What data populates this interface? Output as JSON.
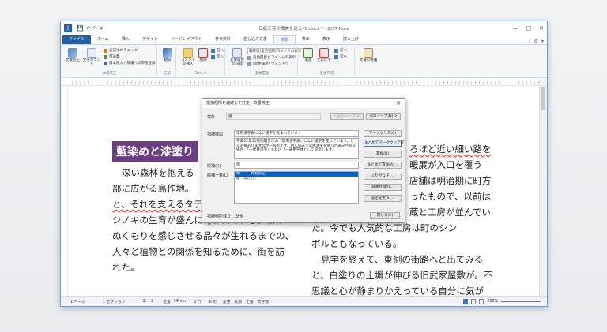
{
  "window": {
    "title": "伝統工芸の職美を巡るPC.docx * - JUST Note",
    "app_icon": "J",
    "qat": [
      "💾",
      "↶",
      "↷",
      "▾"
    ],
    "controls": [
      "—",
      "□",
      "✕"
    ]
  },
  "tabs": [
    "ファイル",
    "ホーム",
    "挿入",
    "デザイン",
    "ページレイアウト",
    "参考資料",
    "差し込み文書",
    "校閲",
    "表示",
    "表示",
    "読み上げ"
  ],
  "tab_right": [
    "?",
    "⚙",
    "▾"
  ],
  "ribbon": {
    "groups": [
      "文書校正",
      "言語",
      "コメント",
      "変更履歴",
      "変更内容"
    ],
    "proof": {
      "check": "文書校正",
      "count": "文字カウント",
      "items": [
        "表記ゆれチェック",
        "用語集",
        "日本語入力辞書への単語登録"
      ]
    },
    "lang": {
      "translate": "翻訳"
    },
    "comment": {
      "insert": "コメントの挿入",
      "delete": "削除",
      "prev": "前へ",
      "next": "次へ"
    },
    "track": {
      "record": "変更履歴の記録",
      "view": "最終版(変更箇所/コメントの表示",
      "show": "変更履歴とコメントの表示",
      "pane": "[変更履歴] ウィンドウ"
    },
    "changes": {
      "accept": "承諾",
      "reject": "元に戻す",
      "prev": "前へ",
      "next": "次へ",
      "protect": "文書の保護"
    }
  },
  "document": {
    "heading": "藍染めと漆塗り",
    "left_lines": [
      "深い森林を抱える",
      "部に広がる島作地。",
      "と、それを支えるタテ",
      "シノキの生育が盛んに行われている。和の",
      "ぬくもりを感じさせる品々が生れるまでの、",
      "人々と植物との関係を知るために、街を訪",
      "れた。"
    ],
    "right_lines": [
      "ろほど近い細い路を",
      "暖簾が入口を覆う",
      "店舗は明治期に町方",
      "ったもので、以前は",
      "蔵と工房が並んでい",
      "た。今でも人気的な工房は町のシン",
      "ボルともなっている。",
      "見学を終えて、東側の街路へと出てみる",
      "と、白塗りの土塀が伸びる旧武家屋敷が。不",
      "思議と心が静まりかえっている自分に気が"
    ]
  },
  "dialog": {
    "title": "指摘個所を連続して訂正 - 文書校正",
    "close": "✕",
    "target_label": "対象",
    "target_value": "畠",
    "prev_btn": "< 前のマーク(B)",
    "next_btn": "次のマーク(N) >",
    "reason_label": "指摘理由",
    "reason_title": "常用漢字表にない漢字が含まれています",
    "reason_text": "平成22年11月内閣告示の『常用漢字表』にない漢字を使っています。ぜる必要ありますのが一般的です。用し読みで常用漢字を使った表記がある場合、「一代替漢字」または「一通用字体として提示します」",
    "candidate_label": "候補(K)",
    "candidate_value": "畑",
    "list_label": "候補一覧(L)",
    "list_items": [
      "畑・・・代替表記",
      "畠（はたけ）"
    ],
    "buttons": [
      "マーククリア(C)",
      "まとめてマーククリア(T)",
      "置換(R)",
      "まとめて置換(A)...",
      "ふりがな(F)...",
      "辞書登録(J)...",
      "設定変更(S)..."
    ],
    "count_label": "指摘個所残り：28個",
    "close_btn": "閉じる(C)"
  },
  "status": {
    "page": "1 ページ",
    "section": "1 セクション",
    "pages": "1/",
    "pages_total": "2",
    "position": "位置",
    "position_val": "54mm",
    "line": "3 行",
    "col": "6 桁",
    "modes": [
      "変更",
      "拡張",
      "上書",
      "文字数"
    ],
    "zoom": "200%"
  },
  "colors": {
    "accent": "#1e5fa8",
    "heading_bg": "#6b3d84"
  }
}
